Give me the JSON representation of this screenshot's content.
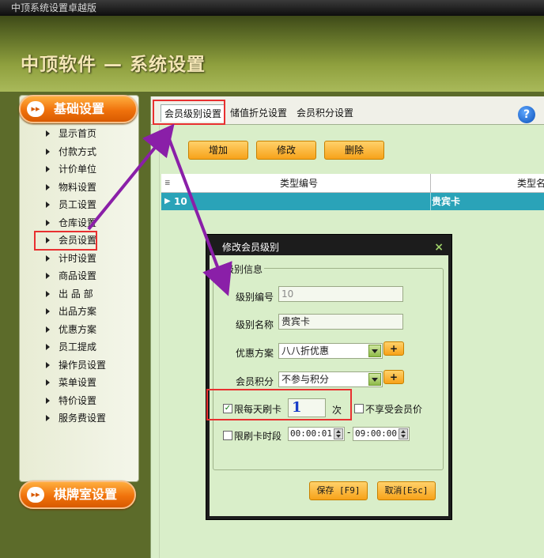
{
  "window": {
    "title": "中顶系统设置卓越版"
  },
  "header": {
    "title": "中顶软件 — 系统设置"
  },
  "sidebar": {
    "section_title": "基础设置",
    "items": [
      {
        "label": "显示首页"
      },
      {
        "label": "付款方式"
      },
      {
        "label": "计价单位"
      },
      {
        "label": "物料设置"
      },
      {
        "label": "员工设置"
      },
      {
        "label": "仓库设置"
      },
      {
        "label": "会员设置"
      },
      {
        "label": "计时设置"
      },
      {
        "label": "商品设置"
      },
      {
        "label": "出 品 部"
      },
      {
        "label": "出品方案"
      },
      {
        "label": "优惠方案"
      },
      {
        "label": "员工提成"
      },
      {
        "label": "操作员设置"
      },
      {
        "label": "菜单设置"
      },
      {
        "label": "特价设置"
      },
      {
        "label": "服务费设置"
      }
    ],
    "active_item": "会员设置",
    "footer_section": "棋牌室设置"
  },
  "tabs": [
    {
      "label": "会员级别设置"
    },
    {
      "label": "储值折兑设置"
    },
    {
      "label": "会员积分设置"
    }
  ],
  "toolbar": {
    "add": "增加",
    "edit": "修改",
    "delete": "删除"
  },
  "grid": {
    "columns": [
      "类型编号",
      "类型名"
    ],
    "rows": [
      {
        "code": "10",
        "name": "贵宾卡"
      }
    ]
  },
  "dialog": {
    "title": "修改会员级别",
    "close_glyph": "×",
    "group_label": "级别信息",
    "level_code_label": "级别编号",
    "level_code_value": "10",
    "level_name_label": "级别名称",
    "level_name_value": "贵宾卡",
    "discount_label": "优惠方案",
    "discount_value": "八八折优惠",
    "points_label": "会员积分",
    "points_value": "不参与积分",
    "plus": "+",
    "daily_limit_label": "限每天刷卡",
    "daily_limit_checked": true,
    "daily_limit_value": "1",
    "times_unit": "次",
    "no_member_price_label": "不享受会员价",
    "period_label": "限刷卡时段",
    "time_from": "00:00:01",
    "time_sep": "-",
    "time_to": "09:00:00",
    "save_button": "保存 [F9]",
    "cancel_button": "取消[Esc]"
  },
  "help": {
    "glyph": "?"
  },
  "colors": {
    "accent_orange": "#f7a21a",
    "grid_highlight": "#2aa3b8",
    "annotation_red": "#e83030",
    "arrow_purple": "#8a1fa8"
  }
}
